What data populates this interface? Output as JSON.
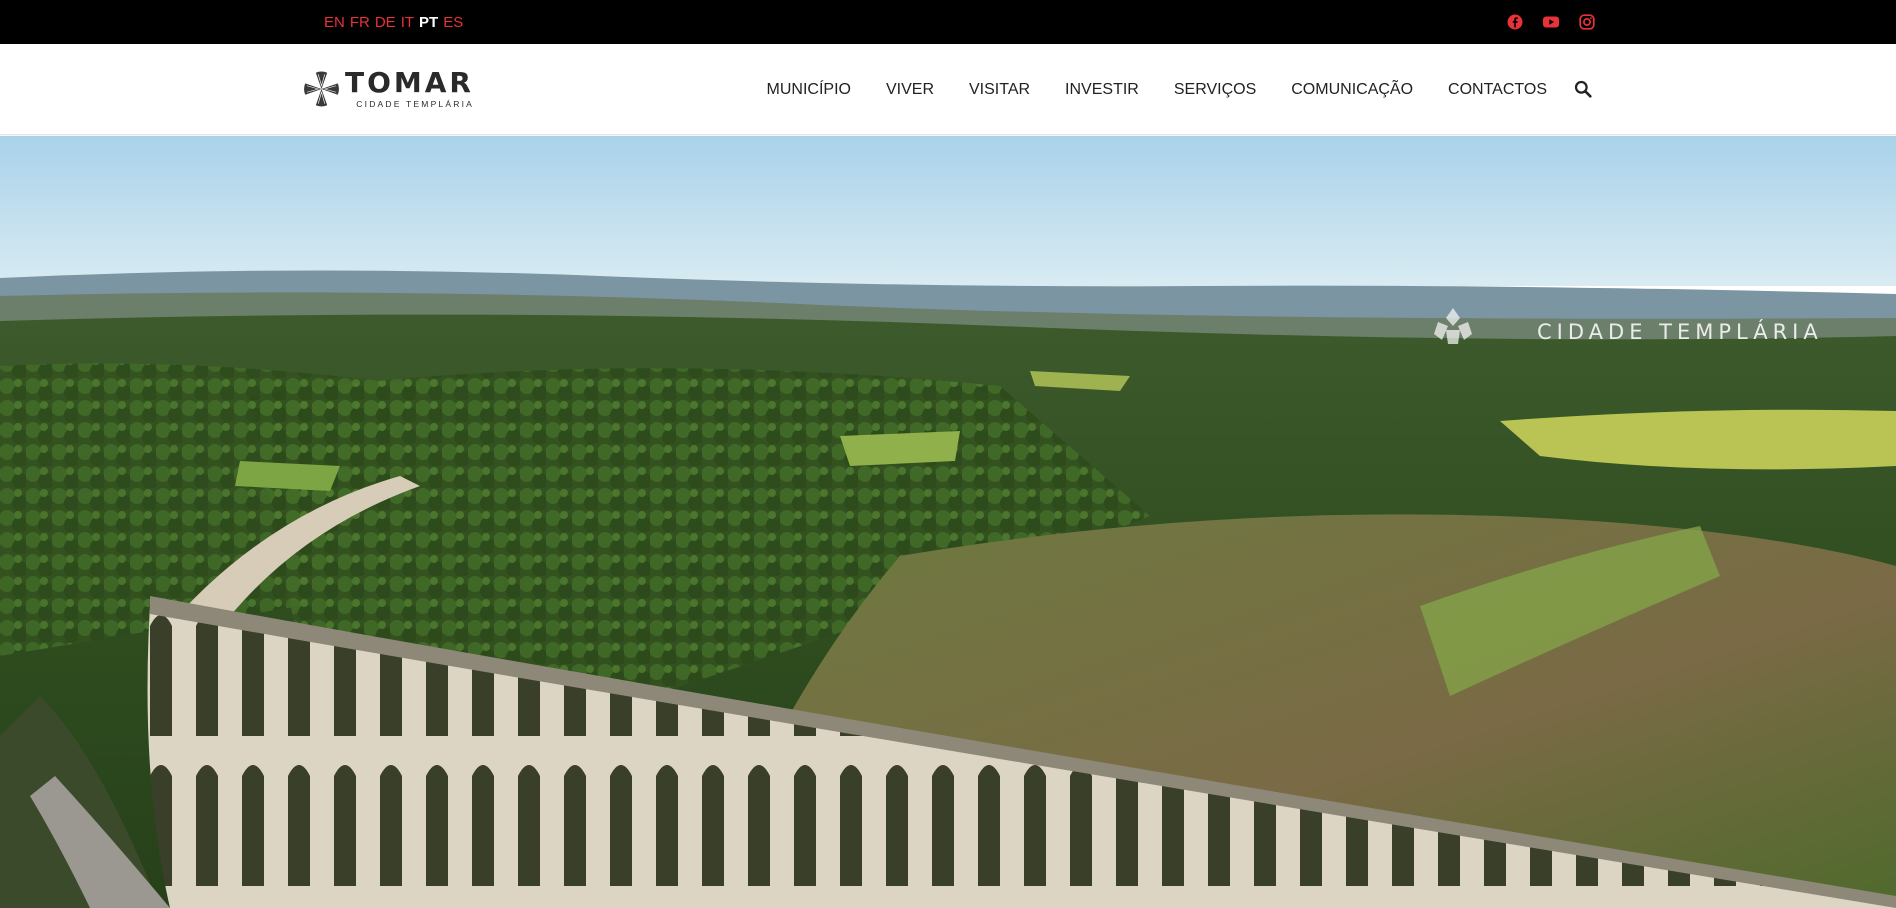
{
  "languages": [
    {
      "code": "EN",
      "active": false
    },
    {
      "code": "FR",
      "active": false
    },
    {
      "code": "DE",
      "active": false
    },
    {
      "code": "IT",
      "active": false
    },
    {
      "code": "PT",
      "active": true
    },
    {
      "code": "ES",
      "active": false
    }
  ],
  "social": [
    "facebook-icon",
    "youtube-icon",
    "instagram-icon"
  ],
  "colors": {
    "accent": "#e8323a",
    "topbar": "#000000",
    "text": "#222222"
  },
  "logo": {
    "title": "TOMAR",
    "subtitle": "CIDADE TEMPLÁRIA"
  },
  "nav": {
    "items": [
      "MUNICÍPIO",
      "VIVER",
      "VISITAR",
      "INVESTIR",
      "SERVIÇOS",
      "COMUNICAÇÃO",
      "CONTACTOS"
    ],
    "search_icon": "search-icon"
  },
  "hero": {
    "watermark_subtitle": "CIDADE TEMPLÁRIA"
  }
}
